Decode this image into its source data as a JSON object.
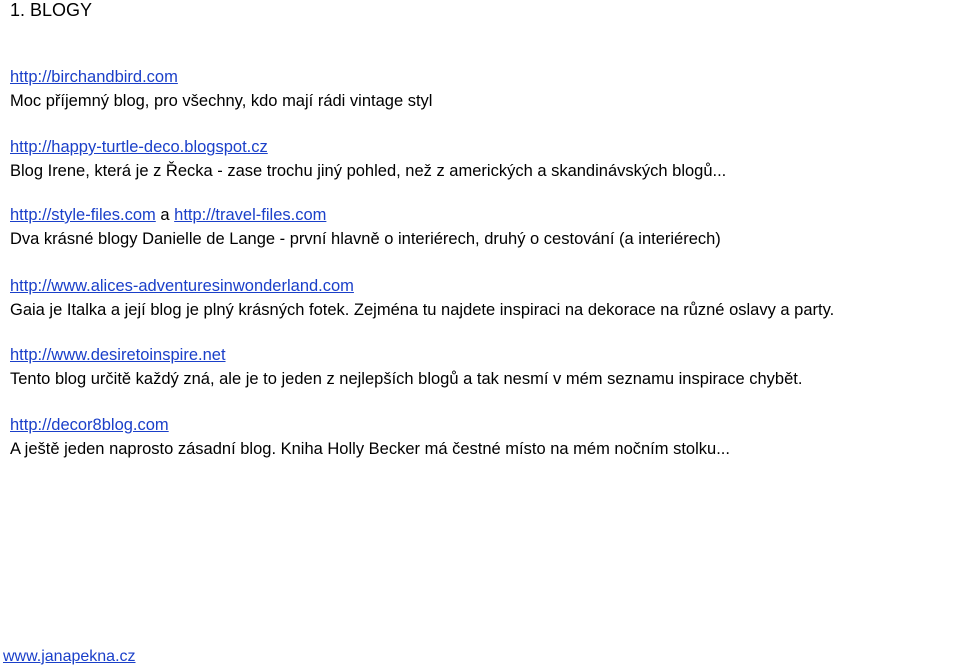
{
  "heading": "1. BLOGY",
  "entries": [
    {
      "link1": "http://birchandbird.com",
      "desc": "Moc příjemný blog, pro všechny, kdo mají rádi vintage styl"
    },
    {
      "link1": "http://happy-turtle-deco.blogspot.cz",
      "desc": "Blog Irene, která je z Řecka - zase trochu jiný pohled, než z amerických a skandinávských blogů..."
    },
    {
      "link1": "http://style-files.com",
      "joiner": " a ",
      "link2": "http://travel-files.com",
      "desc": "Dva krásné blogy Danielle de Lange - první hlavně o interiérech, druhý o cestování (a interiérech)"
    },
    {
      "link1": "http://www.alices-adventuresinwonderland.com",
      "desc": "Gaia je Italka a její blog je plný krásných fotek. Zejména tu najdete inspiraci na dekorace na různé oslavy a party."
    },
    {
      "link1": "http://www.desiretoinspire.net",
      "desc": "Tento blog určitě každý zná, ale je to jeden z nejlepších blogů a tak nesmí v mém seznamu inspirace chybět."
    },
    {
      "link1": "http://decor8blog.com",
      "desc": "A ještě jeden naprosto zásadní blog. Kniha Holly Becker má čestné místo na mém nočním stolku..."
    }
  ],
  "footer": {
    "link": "www.janapekna.cz"
  }
}
